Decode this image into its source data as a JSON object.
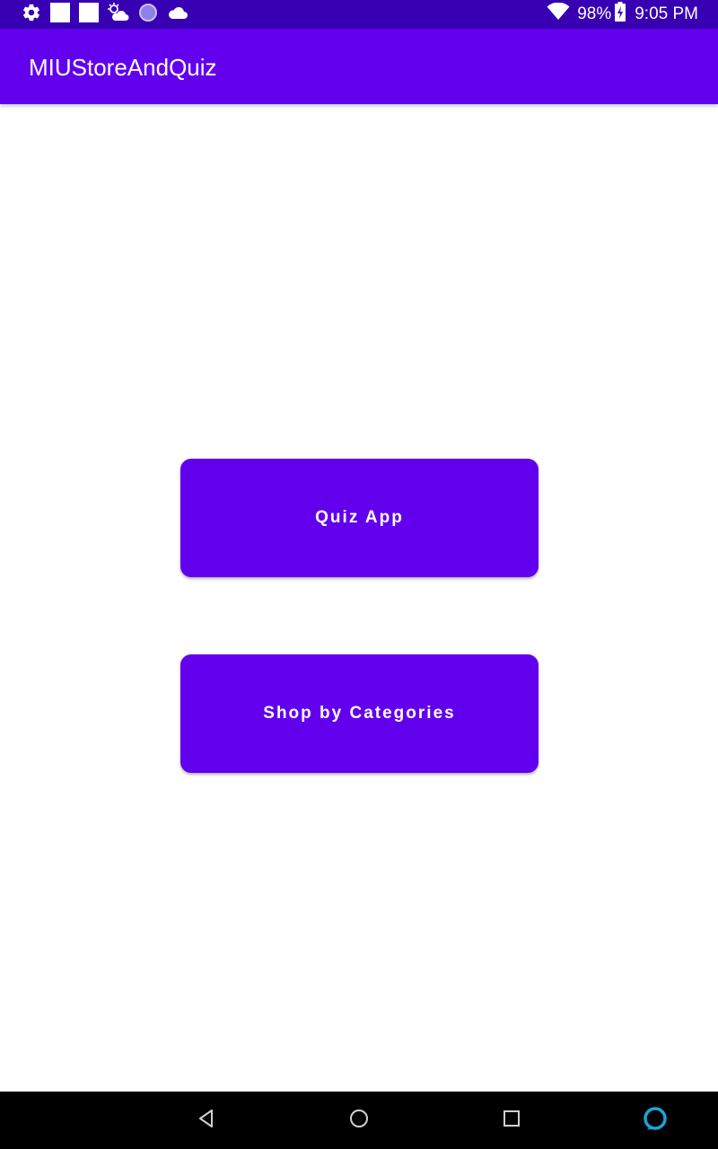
{
  "status_bar": {
    "battery_percent": "98%",
    "time": "9:05 PM",
    "left_icons": [
      "settings-icon",
      "notification-square-icon",
      "notification-square-icon",
      "weather-icon",
      "circle-app-icon",
      "cloud-icon"
    ],
    "right_icons": [
      "wifi-icon",
      "battery-charging-icon"
    ],
    "background": "#3700b3"
  },
  "app_bar": {
    "title": "MIUStoreAndQuiz",
    "background": "#6200ee"
  },
  "main": {
    "quiz_button_label": "Quiz App",
    "shop_button_label": "Shop by Categories",
    "button_color": "#6200ee"
  },
  "nav_bar": {
    "icons": [
      "back-icon",
      "home-icon",
      "recents-icon",
      "assistant-icon"
    ],
    "assistant_color": "#1aa4d8"
  }
}
